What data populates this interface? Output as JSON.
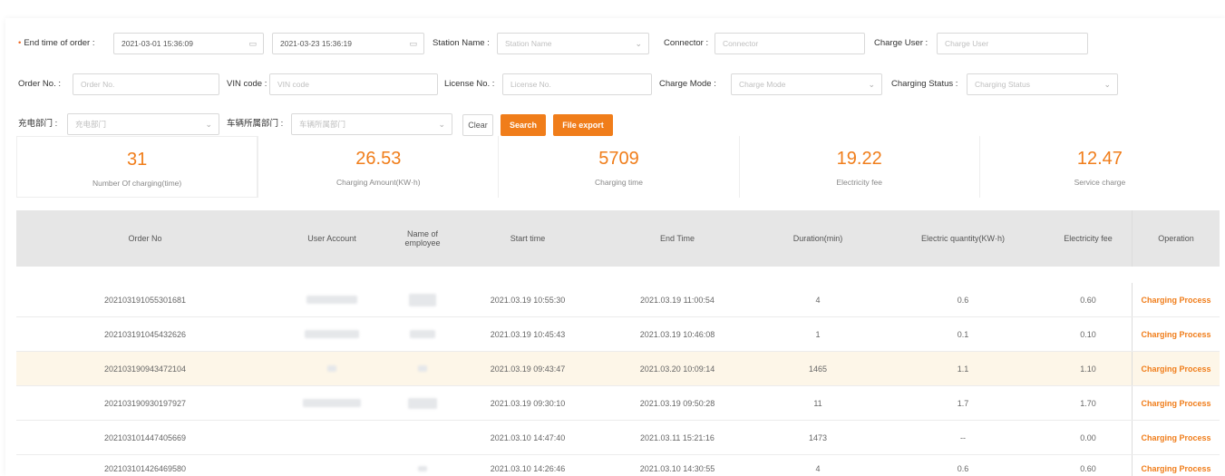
{
  "filters": {
    "row1": {
      "end_time_label": "End time of order :",
      "start_value": "2021-03-01 15:36:09",
      "end_value": "2021-03-23 15:36:19",
      "station_label": "Station Name :",
      "station_placeholder": "Station Name",
      "connector_label": "Connector :",
      "connector_placeholder": "Connector",
      "charge_user_label": "Charge User :",
      "charge_user_placeholder": "Charge User"
    },
    "row2": {
      "order_label": "Order No. :",
      "order_placeholder": "Order No.",
      "vin_label": "VIN code :",
      "vin_placeholder": "VIN code",
      "license_label": "License No. :",
      "license_placeholder": "License No.",
      "mode_label": "Charge Mode :",
      "mode_placeholder": "Charge Mode",
      "status_label": "Charging Status :",
      "status_placeholder": "Charging Status"
    },
    "row3": {
      "dept_label": "充电部门 :",
      "dept_placeholder": "充电部门",
      "vehicle_dept_label": "车辆所属部门 :",
      "vehicle_dept_placeholder": "车辆所属部门",
      "clear": "Clear",
      "search": "Search",
      "export": "File export"
    }
  },
  "stats": [
    {
      "value": "31",
      "label": "Number Of charging(time)"
    },
    {
      "value": "26.53",
      "label": "Charging Amount(KW·h)"
    },
    {
      "value": "5709",
      "label": "Charging time"
    },
    {
      "value": "19.22",
      "label": "Electricity fee"
    },
    {
      "value": "12.47",
      "label": "Service charge"
    }
  ],
  "table": {
    "headers": {
      "order_no": "Order No",
      "user_account": "User Account",
      "employee": "Name of employee",
      "start_time": "Start time",
      "end_time": "End Time",
      "duration": "Duration(min)",
      "quantity": "Electric quantity(KW·h)",
      "fee": "Electricity fee",
      "operation": "Operation"
    },
    "rows": [
      {
        "order_no": "202103191055301681",
        "start": "2021.03.19 10:55:30",
        "end": "2021.03.19 11:00:54",
        "duration": "4",
        "qty": "0.6",
        "fee": "0.60",
        "op": "Charging Process"
      },
      {
        "order_no": "202103191045432626",
        "start": "2021.03.19 10:45:43",
        "end": "2021.03.19 10:46:08",
        "duration": "1",
        "qty": "0.1",
        "fee": "0.10",
        "op": "Charging Process"
      },
      {
        "order_no": "202103190943472104",
        "start": "2021.03.19 09:43:47",
        "end": "2021.03.20 10:09:14",
        "duration": "1465",
        "qty": "1.1",
        "fee": "1.10",
        "op": "Charging Process"
      },
      {
        "order_no": "202103190930197927",
        "start": "2021.03.19 09:30:10",
        "end": "2021.03.19 09:50:28",
        "duration": "11",
        "qty": "1.7",
        "fee": "1.70",
        "op": "Charging Process"
      },
      {
        "order_no": "202103101447405669",
        "start": "2021.03.10 14:47:40",
        "end": "2021.03.11 15:21:16",
        "duration": "1473",
        "qty": "--",
        "fee": "0.00",
        "op": "Charging Process"
      },
      {
        "order_no": "202103101426469580",
        "start": "2021.03.10 14:26:46",
        "end": "2021.03.10 14:30:55",
        "duration": "4",
        "qty": "0.6",
        "fee": "0.60",
        "op": "Charging Process"
      }
    ]
  },
  "icons": {
    "calendar": "calendar-icon",
    "chevron": "chevron-down-icon"
  },
  "colors": {
    "accent": "#f07d1a",
    "highlight_row": "#fdf6e8",
    "header_bg": "#e6e6e6"
  }
}
